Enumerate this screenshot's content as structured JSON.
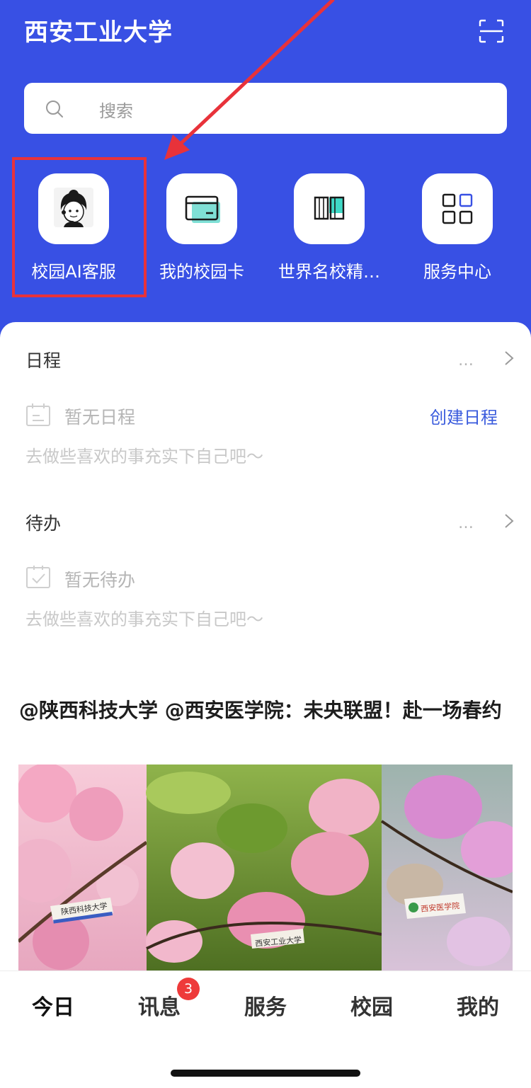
{
  "header": {
    "title": "西安工业大学",
    "bg_color": "#3850e4"
  },
  "search": {
    "placeholder": "搜索"
  },
  "quick_actions": [
    {
      "label": "校园AI客服",
      "icon": "headset-agent-icon"
    },
    {
      "label": "我的校园卡",
      "icon": "campus-card-icon"
    },
    {
      "label": "世界名校精…",
      "icon": "open-book-icon"
    },
    {
      "label": "服务中心",
      "icon": "grid-apps-icon"
    }
  ],
  "schedule": {
    "title": "日程",
    "more": "…",
    "empty_text": "暂无日程",
    "hint": "去做些喜欢的事充实下自己吧～",
    "create_link": "创建日程"
  },
  "todo": {
    "title": "待办",
    "more": "…",
    "empty_text": "暂无待办",
    "hint": "去做些喜欢的事充实下自己吧～"
  },
  "news": {
    "title": "@陕西科技大学 @西安医学院：未央联盟！赴一场春约",
    "photo_labels": [
      "陕西科技大学",
      "西安工业大学",
      "西安医学院"
    ]
  },
  "tabbar": {
    "tabs": [
      "今日",
      "讯息",
      "服务",
      "校园",
      "我的"
    ],
    "active_index": 0,
    "badge_count": "3"
  },
  "colors": {
    "accent": "#3850e4",
    "link": "#3a5bdd",
    "highlight": "#e8323a",
    "badge": "#ee3a3a"
  }
}
